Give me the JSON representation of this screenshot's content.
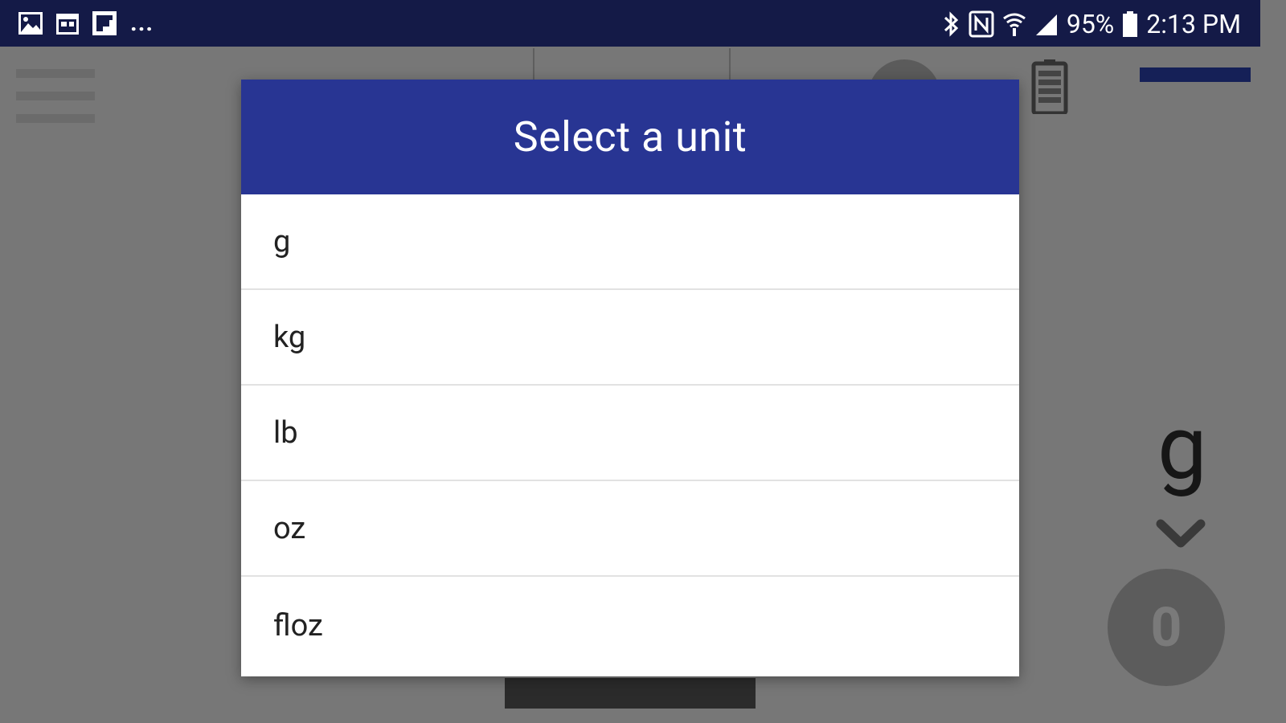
{
  "status_bar": {
    "battery_percent": "95%",
    "time": "2:13 PM",
    "overflow_indicator": "...",
    "left_icons": [
      "gallery-icon",
      "calendar-icon",
      "flipboard-icon"
    ],
    "right_icons": [
      "bluetooth-icon",
      "nfc-icon",
      "wifi-icon",
      "signal-icon",
      "battery-icon"
    ]
  },
  "background_app": {
    "current_unit": "g",
    "tare_value": "0"
  },
  "dialog": {
    "title": "Select a unit",
    "units": [
      "g",
      "kg",
      "lb",
      "oz",
      "floz"
    ]
  },
  "colors": {
    "status_bar": "#141a47",
    "dialog_header": "#283593",
    "scrim": "#777777"
  }
}
